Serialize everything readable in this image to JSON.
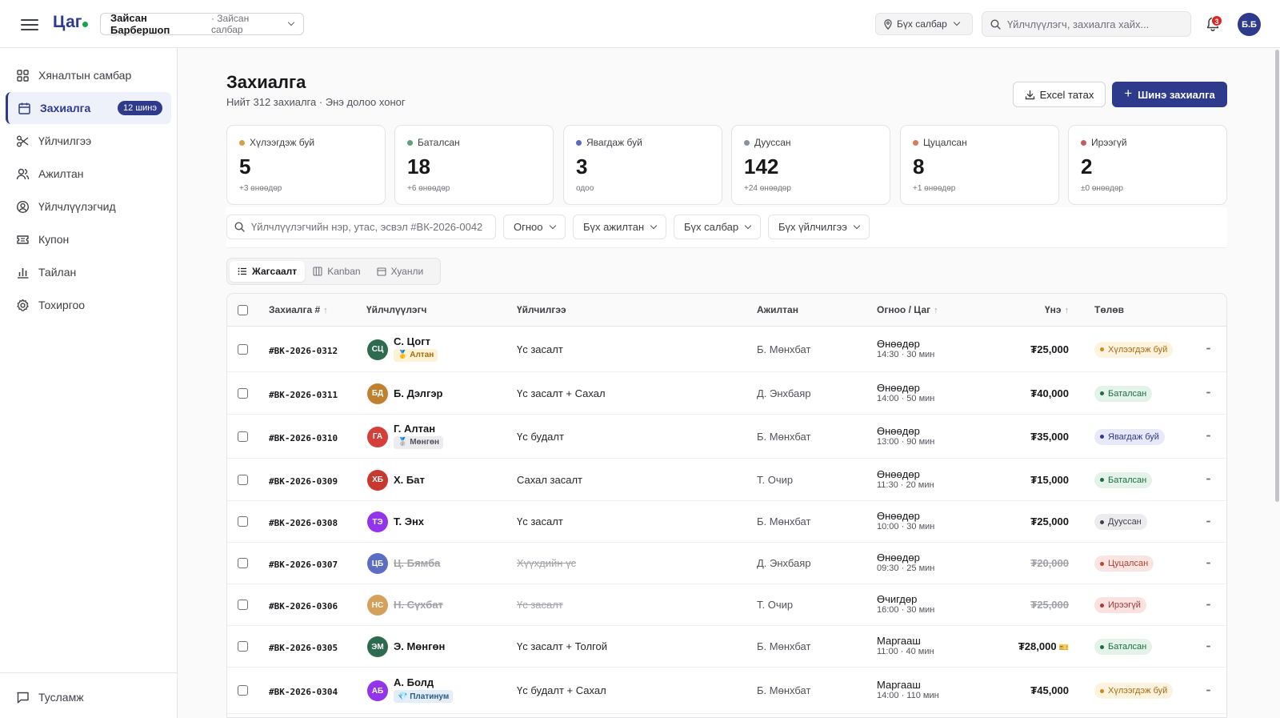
{
  "header": {
    "logo": "Цаг",
    "business_name": "Зайсан Барбершоп",
    "business_branch": "· Зайсан салбар",
    "branch_filter": "Бүх салбар",
    "search_placeholder": "Үйлчлүүлэгч, захиалга хайх...",
    "notification_count": "3",
    "user_initials": "Б.Б",
    "icons": [
      "menu-icon",
      "chevron-down-icon",
      "map-pin-icon",
      "search-icon",
      "bell-icon"
    ]
  },
  "sidebar": {
    "items": [
      {
        "label": "Хяналтын самбар",
        "icon": "dashboard-grid-icon"
      },
      {
        "label": "Захиалга",
        "icon": "calendar-icon",
        "badge": "12 шинэ",
        "active": true
      },
      {
        "label": "Үйлчилгээ",
        "icon": "scissors-icon"
      },
      {
        "label": "Ажилтан",
        "icon": "users-icon"
      },
      {
        "label": "Үйлчлүүлэгчид",
        "icon": "user-circle-icon"
      },
      {
        "label": "Купон",
        "icon": "ticket-icon"
      },
      {
        "label": "Тайлан",
        "icon": "bar-chart-icon"
      },
      {
        "label": "Тохиргоо",
        "icon": "gear-icon"
      }
    ],
    "help_label": "Тусламж"
  },
  "main": {
    "title": "Захиалга",
    "subtitle": "Нийт 312 захиалга · Энэ долоо хоног",
    "export_label": "Excel татах",
    "new_label": "Шинэ захиалга",
    "stats": [
      {
        "label": "Хүлээгдэж буй",
        "value": "5",
        "delta": "+3 өнөөдөр",
        "color": "#d4a04a"
      },
      {
        "label": "Баталсан",
        "value": "18",
        "delta": "+6 өнөөдөр",
        "color": "#5fa079"
      },
      {
        "label": "Явагдаж буй",
        "value": "3",
        "delta": "одоо",
        "color": "#5b67c4"
      },
      {
        "label": "Дууссан",
        "value": "142",
        "delta": "+24 өнөөдөр",
        "color": "#8a8f9c"
      },
      {
        "label": "Цуцалсан",
        "value": "8",
        "delta": "+1 өнөөдөр",
        "color": "#d97a5a"
      },
      {
        "label": "Ирээгүй",
        "value": "2",
        "delta": "±0 өнөөдөр",
        "color": "#c0605e"
      }
    ],
    "filters": {
      "search_placeholder": "Үйлчлүүлэгчийн нэр, утас, эсвэл #ВК-2026-0042",
      "date": "Огноо",
      "staff": "Бүх ажилтан",
      "branch": "Бүх салбар",
      "service": "Бүх үйлчилгээ"
    },
    "view_tabs": [
      "Жагсаалт",
      "Kanban",
      "Хуанли"
    ],
    "columns": [
      "Захиалга #",
      "Үйлчлүүлэгч",
      "Үйлчилгээ",
      "Ажилтан",
      "Огноо / Цаг",
      "Үнэ",
      "Төлөв"
    ],
    "rows": [
      {
        "id": "#ВК-2026-0312",
        "initials": "СЦ",
        "avatar_color": "#2d6a4f",
        "name": "С. Цогт",
        "tier": "🥇 Алтан",
        "service": "Үс засалт",
        "staff": "Б. Мөнхбат",
        "day": "Өнөөдөр",
        "time": "14:30 · 30 мин",
        "price": "₮25,000",
        "status": "Хүлээгдэж буй",
        "struck": false
      },
      {
        "id": "#ВК-2026-0311",
        "initials": "БД",
        "avatar_color": "#c0802f",
        "name": "Б. Дэлгэр",
        "tier": "",
        "service": "Үс засалт + Сахал",
        "staff": "Д. Энхбаяр",
        "day": "Өнөөдөр",
        "time": "14:00 · 50 мин",
        "price": "₮40,000",
        "status": "Баталсан",
        "struck": false
      },
      {
        "id": "#ВК-2026-0310",
        "initials": "ГА",
        "avatar_color": "#d43f3a",
        "name": "Г. Алтан",
        "tier": "🥈 Мөнгөн",
        "service": "Үс будалт",
        "staff": "Б. Мөнхбат",
        "day": "Өнөөдөр",
        "time": "13:00 · 90 мин",
        "price": "₮35,000",
        "status": "Явагдаж буй",
        "struck": false
      },
      {
        "id": "#ВК-2026-0309",
        "initials": "ХБ",
        "avatar_color": "#c8382e",
        "name": "Х. Бат",
        "tier": "",
        "service": "Сахал засалт",
        "staff": "Т. Очир",
        "day": "Өнөөдөр",
        "time": "11:30 · 20 мин",
        "price": "₮15,000",
        "status": "Баталсан",
        "struck": false
      },
      {
        "id": "#ВК-2026-0308",
        "initials": "ТЭ",
        "avatar_color": "#9333ea",
        "name": "Т. Энх",
        "tier": "",
        "service": "Үс засалт",
        "staff": "Б. Мөнхбат",
        "day": "Өнөөдөр",
        "time": "10:00 · 30 мин",
        "price": "₮25,000",
        "status": "Дууссан",
        "struck": false
      },
      {
        "id": "#ВК-2026-0307",
        "initials": "ЦБ",
        "avatar_color": "#5b6ec4",
        "name": "Ц. Бямба",
        "tier": "",
        "service": "Хүүхдийн үс",
        "staff": "Д. Энхбаяр",
        "day": "Өнөөдөр",
        "time": "09:30 · 25 мин",
        "price": "₮20,000",
        "status": "Цуцалсан",
        "struck": true
      },
      {
        "id": "#ВК-2026-0306",
        "initials": "НС",
        "avatar_color": "#d4a05a",
        "name": "Н. Сүхбат",
        "tier": "",
        "service": "Үс засалт",
        "staff": "Т. Очир",
        "day": "Өчигдөр",
        "time": "16:00 · 30 мин",
        "price": "₮25,000",
        "status": "Ирээгүй",
        "struck": true
      },
      {
        "id": "#ВК-2026-0305",
        "initials": "ЭМ",
        "avatar_color": "#2d6a4f",
        "name": "Э. Мөнгөн",
        "tier": "",
        "service": "Үс засалт + Толгой",
        "staff": "Б. Мөнхбат",
        "day": "Маргааш",
        "time": "11:00 · 40 мин",
        "price": "₮28,000",
        "coupon": "🎫",
        "status": "Баталсан",
        "struck": false
      },
      {
        "id": "#ВК-2026-0304",
        "initials": "АБ",
        "avatar_color": "#9333ea",
        "name": "А. Болд",
        "tier": "💎 Платинум",
        "service": "Үс будалт + Сахал",
        "staff": "Б. Мөнхбат",
        "day": "Маргааш",
        "time": "14:00 · 110 мин",
        "price": "₮45,000",
        "status": "Хүлээгдэж буй",
        "struck": false
      }
    ]
  },
  "status_styles": {
    "Хүлээгдэж буй": {
      "bg": "#fdf3de",
      "fg": "#a86b10",
      "dot": "#d08a1a"
    },
    "Баталсан": {
      "bg": "#e4f3ea",
      "fg": "#1f6b41",
      "dot": "#1f6b41"
    },
    "Явагдаж буй": {
      "bg": "#e7e9f8",
      "fg": "#2e3a8c",
      "dot": "#2e3a8c"
    },
    "Дууссан": {
      "bg": "#ececef",
      "fg": "#3f3f46",
      "dot": "#3f3f46"
    },
    "Цуцалсан": {
      "bg": "#fbe5e2",
      "fg": "#b4412e",
      "dot": "#c0472f"
    },
    "Ирээгүй": {
      "bg": "#f9e2e0",
      "fg": "#9f3a36",
      "dot": "#a63b37"
    }
  },
  "tier_styles": {
    "🥇 Алтан": {
      "bg": "#fdf1d6",
      "fg": "#a0700c"
    },
    "🥈 Мөнгөн": {
      "bg": "#ececef",
      "fg": "#52525b"
    },
    "💎 Платинум": {
      "bg": "#e4eef8",
      "fg": "#2a5a86"
    }
  },
  "colors": {
    "accent": "#2e3a8c",
    "online": "#16a34a",
    "notification": "#dc2626"
  }
}
